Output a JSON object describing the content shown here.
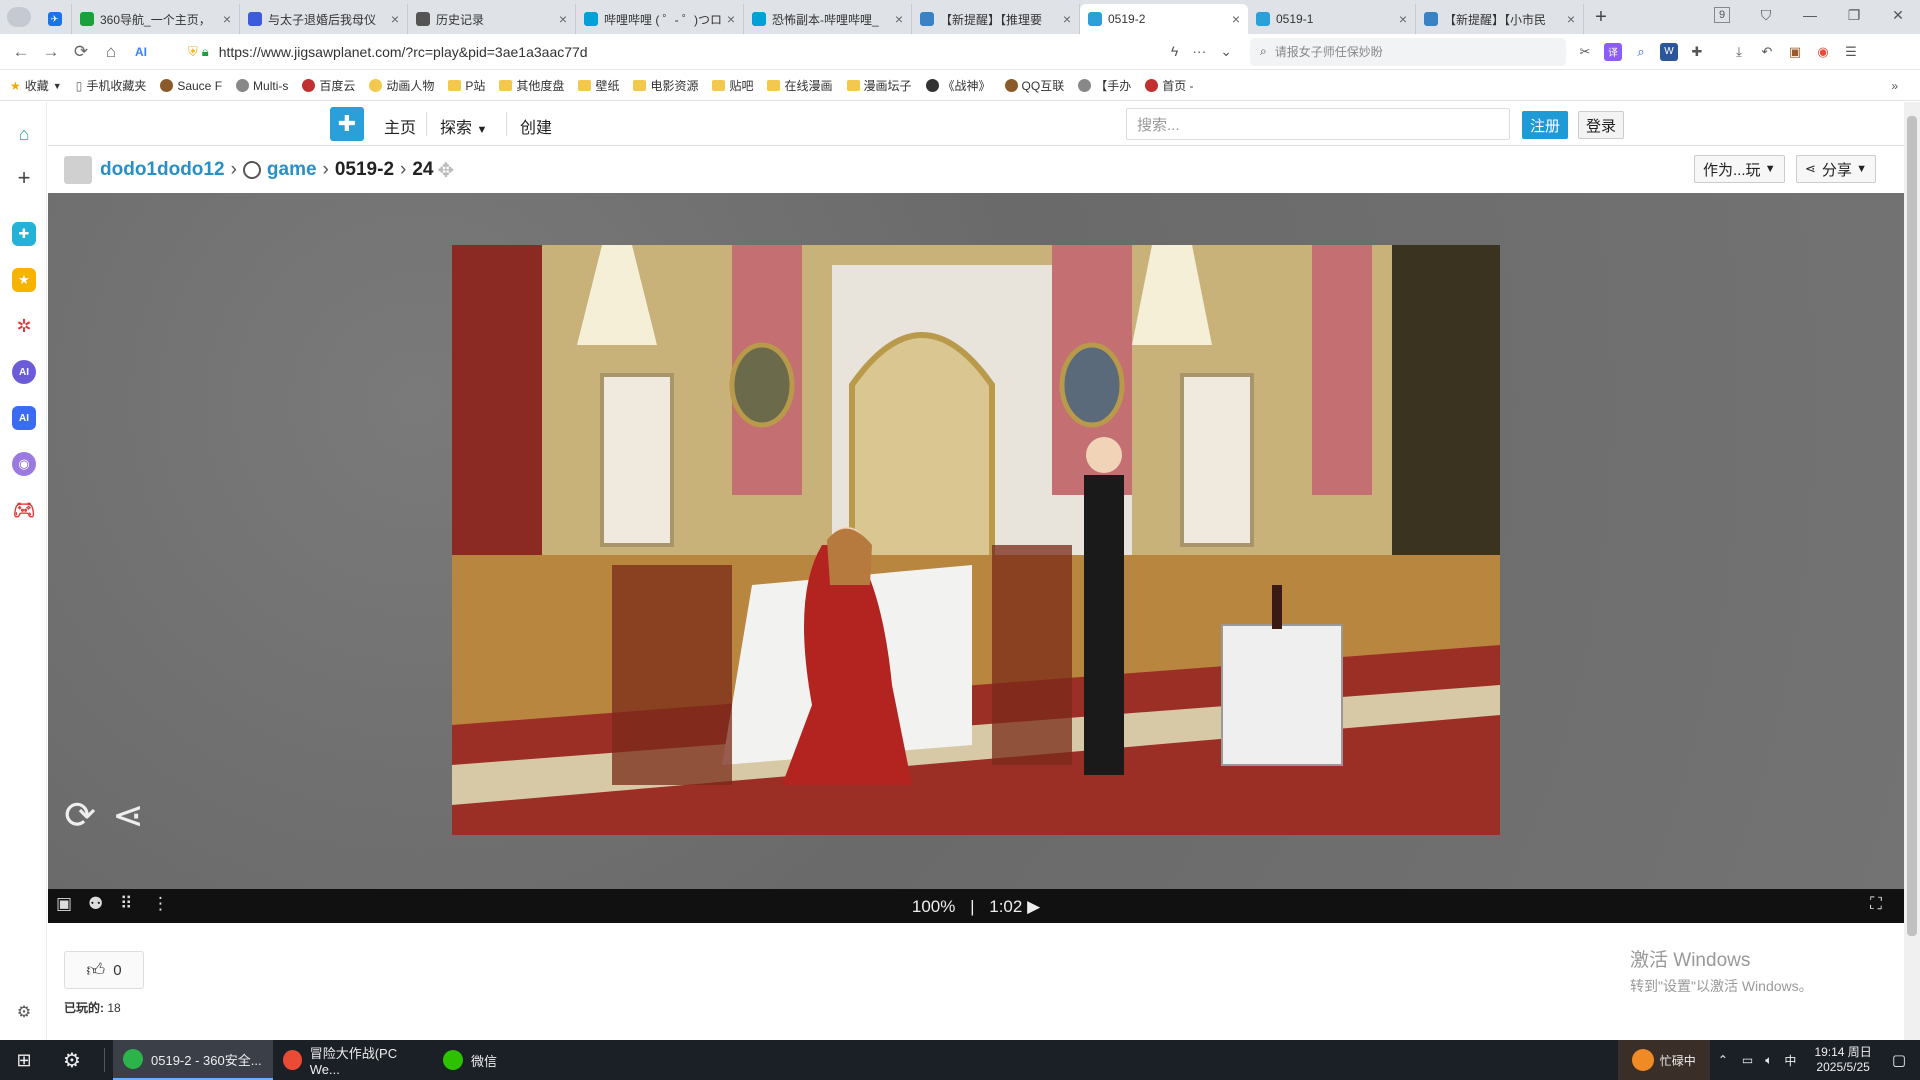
{
  "browser": {
    "tabs": [
      {
        "title": "",
        "color": "#1a73e8"
      },
      {
        "title": "360导航_一个主页，",
        "color": "#1aa13c"
      },
      {
        "title": "与太子退婚后我母仪",
        "color": "#3b5bdb"
      },
      {
        "title": "历史记录",
        "color": "#555555"
      },
      {
        "title": "哔哩哔哩 ( ゜- ゜)つロ",
        "color": "#00a1d6"
      },
      {
        "title": "恐怖副本-哔哩哔哩_",
        "color": "#00a1d6"
      },
      {
        "title": "【新提醒】【推理要",
        "color": "#3b82c4"
      },
      {
        "title": "0519-2",
        "color": "#2a9fd8",
        "active": true
      },
      {
        "title": "0519-1",
        "color": "#2a9fd8"
      },
      {
        "title": "【新提醒】【小市民",
        "color": "#3b82c4"
      }
    ],
    "tab_count_badge": "9",
    "url": "https://www.jigsawplanet.com/?rc=play&pid=3ae1a3aac77d",
    "search_placeholder": "请报女子师任保妙盼",
    "bookmarks": [
      {
        "label": "收藏",
        "kind": "star"
      },
      {
        "label": "手机收藏夹",
        "kind": "file"
      },
      {
        "label": "Sauce F",
        "kind": "icon"
      },
      {
        "label": "Multi-s",
        "kind": "icon"
      },
      {
        "label": "百度云",
        "kind": "icon"
      },
      {
        "label": "动画人物",
        "kind": "icon"
      },
      {
        "label": "P站",
        "kind": "folder"
      },
      {
        "label": "其他度盘",
        "kind": "folder"
      },
      {
        "label": "壁纸",
        "kind": "folder"
      },
      {
        "label": "电影资源",
        "kind": "folder"
      },
      {
        "label": "贴吧",
        "kind": "folder"
      },
      {
        "label": "在线漫画",
        "kind": "folder"
      },
      {
        "label": "漫画坛子",
        "kind": "folder"
      },
      {
        "label": "《战神》",
        "kind": "icon"
      },
      {
        "label": "QQ互联",
        "kind": "icon"
      },
      {
        "label": "【手办",
        "kind": "icon"
      },
      {
        "label": "首页 -",
        "kind": "icon"
      }
    ]
  },
  "site": {
    "nav": {
      "home": "主页",
      "explore": "探索",
      "create": "创建"
    },
    "search_placeholder": "搜索...",
    "register": "注册",
    "login": "登录",
    "breadcrumb": {
      "user": "dodo1dodo12",
      "folder": "game",
      "puzzle": "0519-2",
      "pieces": "24"
    },
    "play_as": "作为...玩",
    "share": "分享",
    "controls": {
      "progress": "100%",
      "time": "1:02"
    },
    "likes": "0",
    "played_label": "已玩的:",
    "played_count": "18"
  },
  "windows_watermark": {
    "line1": "激活 Windows",
    "line2": "转到\"设置\"以激活 Windows。"
  },
  "taskbar": {
    "items": [
      {
        "label": "0519-2 - 360安全...",
        "color": "#2cb34a",
        "active": true
      },
      {
        "label": "冒险大作战(PC We...",
        "color": "#e94b35"
      },
      {
        "label": "微信",
        "color": "#2dc100"
      }
    ],
    "status": "忙碌中",
    "time": "19:14 周日",
    "date": "2025/5/25"
  }
}
